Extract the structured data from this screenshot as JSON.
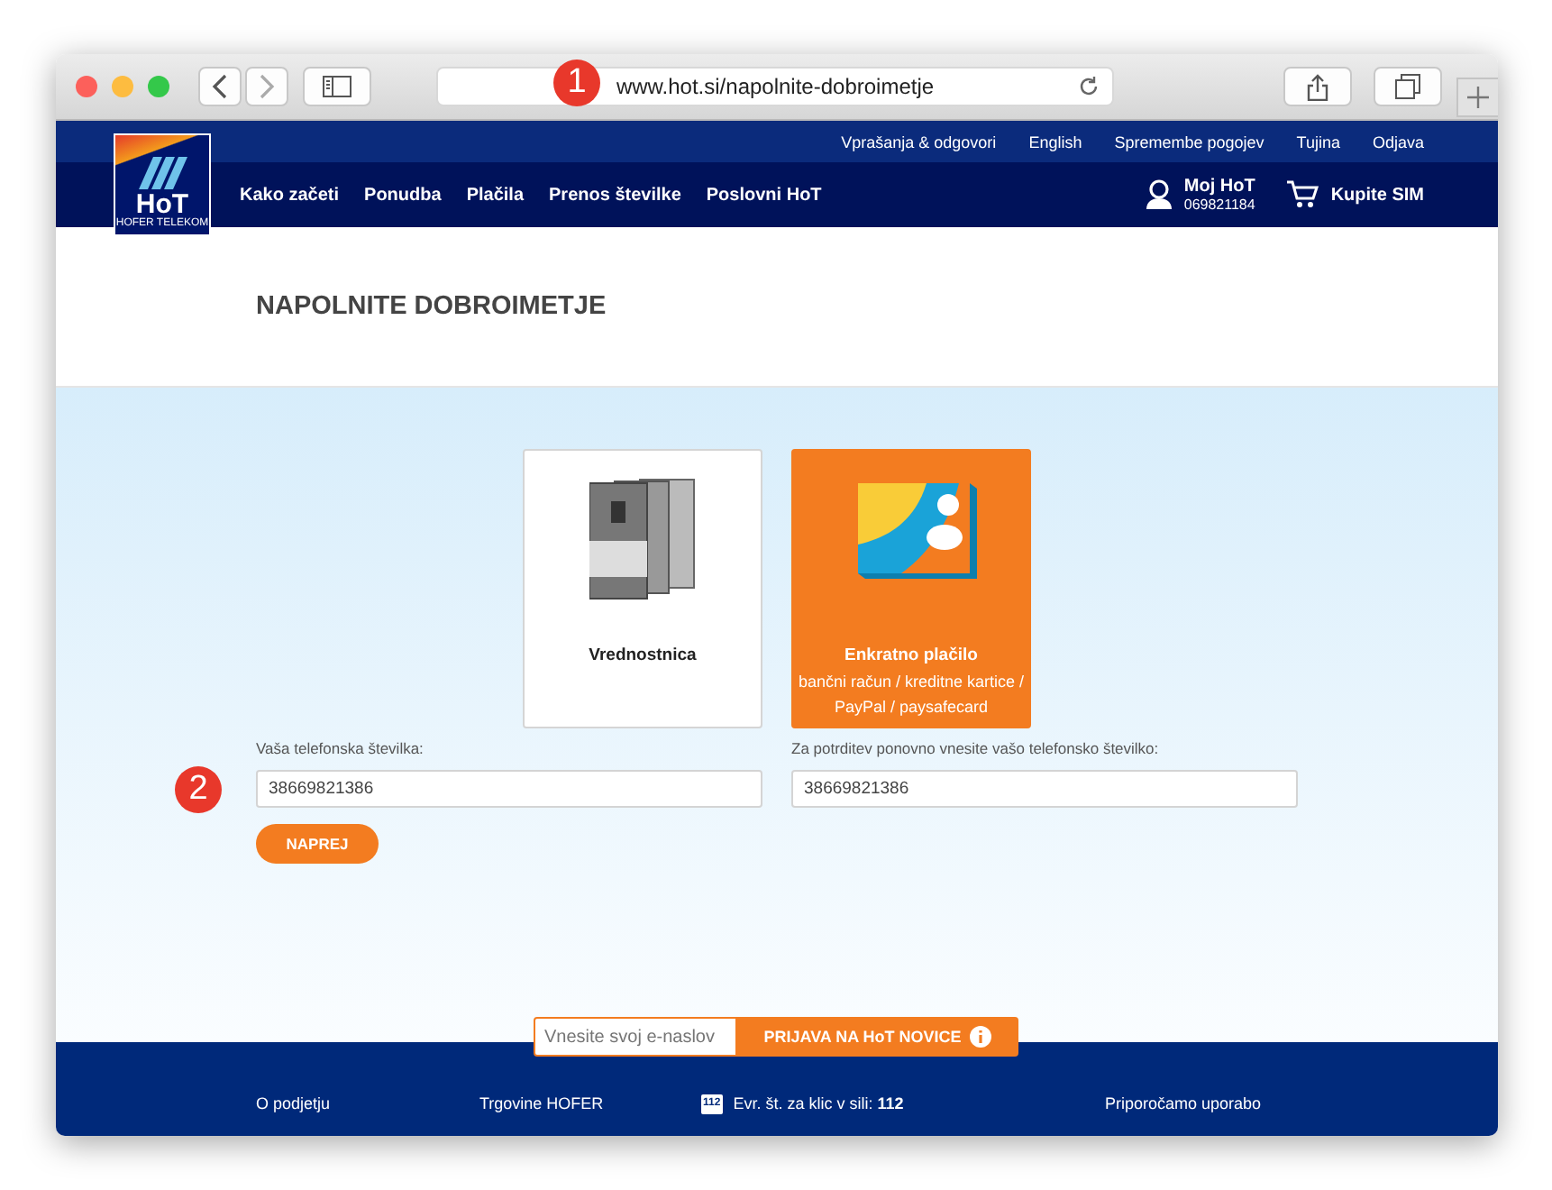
{
  "browser": {
    "url": "www.hot.si/napolnite-dobroimetje"
  },
  "top_links": [
    "Vprašanja & odgovori",
    "English",
    "Spremembe pogojev",
    "Tujina",
    "Odjava"
  ],
  "logo": {
    "text": "HoT",
    "subtext": "HOFER TELEKOM"
  },
  "nav": [
    "Kako začeti",
    "Ponudba",
    "Plačila",
    "Prenos številke",
    "Poslovni HoT"
  ],
  "account": {
    "title": "Moj HoT",
    "number": "069821184"
  },
  "cart": {
    "label": "Kupite SIM"
  },
  "page_title": "NAPOLNITE DOBROIMETJE",
  "payment_options": [
    {
      "kind": "voucher",
      "title": "Vrednostnica",
      "selected": false
    },
    {
      "kind": "card",
      "title": "Enkratno plačilo",
      "subtitle": "bančni račun / kreditne kartice / PayPal / paysafecard",
      "selected": true
    }
  ],
  "fields": [
    {
      "label": "Vaša telefonska številka:",
      "value": "38669821386"
    },
    {
      "label": "Za potrditev ponovno vnesite vašo telefonsko številko:",
      "value": "38669821386"
    }
  ],
  "submit": "NAPREJ",
  "newsletter": {
    "placeholder": "Vnesite svoj e-naslov",
    "button": "PRIJAVA NA HoT NOVICE"
  },
  "footer": [
    {
      "kind": "link",
      "text": "O podjetju"
    },
    {
      "kind": "link",
      "text": "Trgovine HOFER"
    },
    {
      "kind": "emergency",
      "icon_text": "112",
      "text": "Evr. št. za klic v sili: **112**"
    },
    {
      "kind": "link",
      "text": "Priporočamo uporabo"
    }
  ],
  "callouts": [
    "1",
    "2"
  ]
}
